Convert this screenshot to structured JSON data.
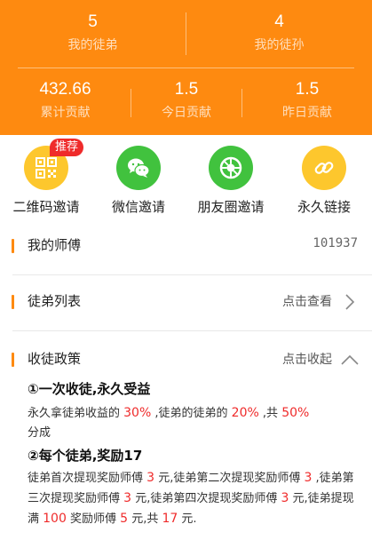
{
  "stats_top": [
    {
      "value": "5",
      "label": "我的徒弟"
    },
    {
      "value": "4",
      "label": "我的徒孙"
    }
  ],
  "stats_bottom": [
    {
      "value": "432.66",
      "label": "累计贡献"
    },
    {
      "value": "1.5",
      "label": "今日贡献"
    },
    {
      "value": "1.5",
      "label": "昨日贡献"
    }
  ],
  "invite": [
    {
      "label": "二维码邀请",
      "icon": "qrcode-icon",
      "color": "#fdc72d",
      "badge": "推荐"
    },
    {
      "label": "微信邀请",
      "icon": "wechat-icon",
      "color": "#41c23e"
    },
    {
      "label": "朋友圈邀请",
      "icon": "moments-icon",
      "color": "#41c23e"
    },
    {
      "label": "永久链接",
      "icon": "link-icon",
      "color": "#fdc72d"
    }
  ],
  "master": {
    "title": "我的师傅",
    "code": "101937"
  },
  "apprentice_list": {
    "title": "徒弟列表",
    "action": "点击查看"
  },
  "policy": {
    "title": "收徒政策",
    "action": "点击收起",
    "heading1": "①一次收徒,永久受益",
    "p1": {
      "t1": "永久拿徒弟收益的 ",
      "v1": "30%",
      "t2": " ,徒弟的徒弟的 ",
      "v2": "20%",
      "t3": " ,共 ",
      "v3": "50%",
      "t4": "分成"
    },
    "heading2": "②每个徒弟,奖励17",
    "p2": {
      "t1": "徒弟首次提现奖励师傅 ",
      "v1": "3",
      "t2": " 元,徒弟第二次提现奖励师傅 ",
      "v2": "3",
      "t3": " ,徒弟第三次提现奖励师傅 ",
      "v3": "3",
      "t4": " 元,徒弟第四次提现奖励师傅 ",
      "v4": "3",
      "t5": " 元,徒弟提现满 ",
      "v5": "100",
      "t6": " 奖励师傅 ",
      "v6": "5",
      "t7": " 元,共 ",
      "v7": "17",
      "t8": " 元."
    }
  },
  "colors": {
    "primary": "#fe8a10",
    "highlight": "#ef2b2b"
  }
}
